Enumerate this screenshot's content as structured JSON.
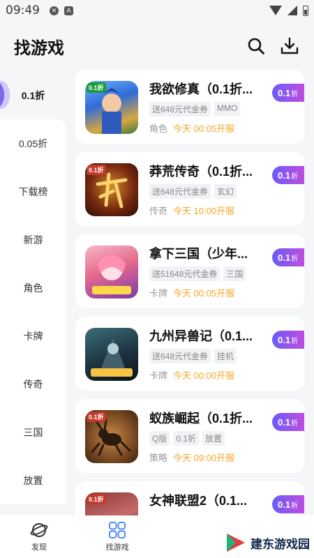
{
  "status_bar": {
    "time": "09:49"
  },
  "header": {
    "title": "找游戏"
  },
  "sidebar": {
    "items": [
      {
        "label": "0.1折"
      },
      {
        "label": "0.05折"
      },
      {
        "label": "下载榜"
      },
      {
        "label": "新游"
      },
      {
        "label": "角色"
      },
      {
        "label": "卡牌"
      },
      {
        "label": "传奇"
      },
      {
        "label": "三国"
      },
      {
        "label": "放置"
      }
    ]
  },
  "games": [
    {
      "name": "我欲修真（0.1折...",
      "tags": [
        "送648元代金券",
        "MMO"
      ],
      "category": "角色",
      "open": "今天 00:05开服",
      "discount": "0.1",
      "discount_unit": "折"
    },
    {
      "name": "莽荒传奇（0.1折...",
      "tags": [
        "送648元代金券",
        "玄幻"
      ],
      "category": "传奇",
      "open": "今天 10:00开服",
      "discount": "0.1",
      "discount_unit": "折"
    },
    {
      "name": "拿下三国（少年...",
      "tags": [
        "送51648元代金券",
        "三国"
      ],
      "category": "卡牌",
      "open": "今天 00:05开服",
      "discount": "0.1",
      "discount_unit": "折"
    },
    {
      "name": "九州异兽记（0.1...",
      "tags": [
        "送648元代金券",
        "挂机"
      ],
      "category": "卡牌",
      "open": "今天 00:00开服",
      "discount": "0.1",
      "discount_unit": "折"
    },
    {
      "name": "蚁族崛起（0.1折...",
      "tags": [
        "Q版",
        "0.1折",
        "放置"
      ],
      "category": "策略",
      "open": "今天 09:00开服",
      "discount": "0.1",
      "discount_unit": "折"
    },
    {
      "name": "女神联盟2（0.1...",
      "tags": [],
      "category": "",
      "open": "",
      "discount": "0.1",
      "discount_unit": "折"
    }
  ],
  "icon_badge": "0.1折",
  "bottom_nav": {
    "items": [
      {
        "label": "发现"
      },
      {
        "label": "找游戏"
      }
    ],
    "watermark": "建东游戏园"
  }
}
